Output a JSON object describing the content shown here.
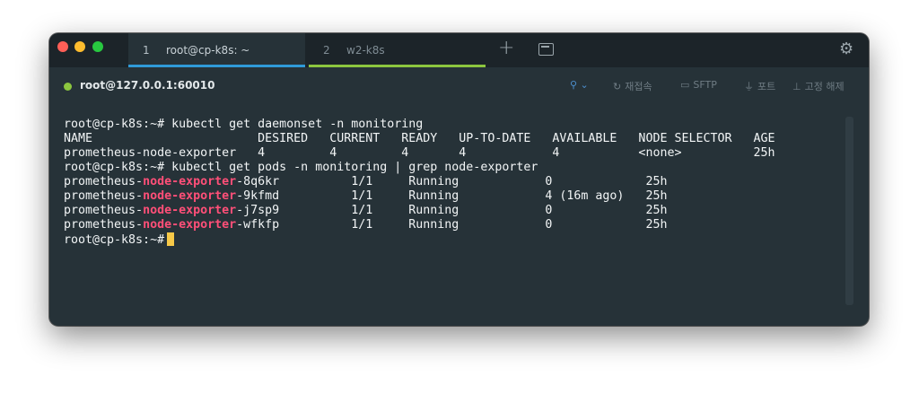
{
  "tabs": [
    {
      "number": "1",
      "title": "root@cp-k8s: ~"
    },
    {
      "number": "2",
      "title": "w2-k8s"
    }
  ],
  "toolbar": {
    "new_tab_glyph": "+",
    "new_tab_icon": "plus-icon",
    "new_window_icon": "window-icon",
    "settings_icon": "gear-icon"
  },
  "session": {
    "host": "root@127.0.0.1:60010",
    "status_color": "#8cc63f"
  },
  "actions": {
    "idea_glyph": "⚲ ⌄",
    "reconnect": "재접속",
    "sftp": "SFTP",
    "port": "포트",
    "unpin": "고정 해제"
  },
  "terminal": {
    "prompt": "root@cp-k8s:~#",
    "command1": " kubectl get daemonset -n monitoring",
    "ds_header": "NAME                       DESIRED   CURRENT   READY   UP-TO-DATE   AVAILABLE   NODE SELECTOR   AGE",
    "ds_row": "prometheus-node-exporter   4         4         4       4            4           <none>          25h",
    "command2": " kubectl get pods -n monitoring | grep node-exporter",
    "pods": [
      {
        "prefix": "prometheus-",
        "match": "node-exporter",
        "suffix": "-8q6kr          1/1     Running            0             25h"
      },
      {
        "prefix": "prometheus-",
        "match": "node-exporter",
        "suffix": "-9kfmd          1/1     Running            4 (16m ago)   25h"
      },
      {
        "prefix": "prometheus-",
        "match": "node-exporter",
        "suffix": "-j7sp9          1/1     Running            0             25h"
      },
      {
        "prefix": "prometheus-",
        "match": "node-exporter",
        "suffix": "-wfkfp          1/1     Running            0             25h"
      }
    ],
    "final_prompt": "root@cp-k8s:~#"
  },
  "colors": {
    "background": "#263238",
    "grep_highlight": "#ff4f78",
    "cursor": "#f7c948",
    "active_tab_underline": "#2f9ad8",
    "tab2_underline": "#8cc63f"
  }
}
